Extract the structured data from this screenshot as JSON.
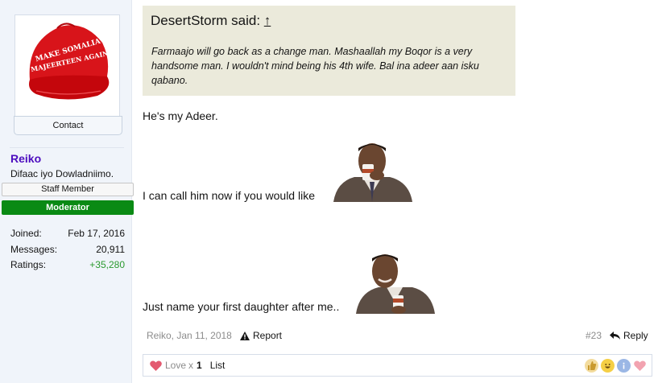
{
  "sidebar": {
    "avatar_text": "MAKE SOMALIA MAJEERTEEN AGAIN",
    "contact_label": "Contact",
    "username": "Reiko",
    "user_title": "Difaac iyo Dowladniimo.",
    "staff_banner": "Staff Member",
    "moderator_banner": "Moderator",
    "stats": [
      {
        "label": "Joined:",
        "value": "Feb 17, 2016"
      },
      {
        "label": "Messages:",
        "value": "20,911"
      },
      {
        "label": "Ratings:",
        "value": "+35,280"
      }
    ]
  },
  "quote": {
    "author_said": "DesertStorm said: ",
    "arrow": "↑",
    "text": "Farmaajo will go back as a change man. Mashaallah my Boqor is a very handsome man. I wouldn't mind being his 4th wife. Bal ina adeer aan isku qabano."
  },
  "message": {
    "line1": "He's my Adeer.",
    "line2": "I can call him now if you would like",
    "line3": "Just name your first daughter after me.."
  },
  "footer": {
    "meta": "Reiko, Jan 11, 2018",
    "report_label": "Report",
    "post_number": "#23",
    "reply_label": "Reply"
  },
  "reactions": {
    "label": "Love",
    "times": "x",
    "count": "1",
    "list_label": "List",
    "buttons": [
      "thumbs-up-icon",
      "laugh-icon",
      "info-icon",
      "heart-icon"
    ]
  },
  "colors": {
    "username": "#4d0dbf",
    "moderator_bg": "#0a8a14",
    "positive": "#2b9a2f",
    "quote_bg": "#ebeadb",
    "sidebar_bg": "#f0f4fa"
  }
}
